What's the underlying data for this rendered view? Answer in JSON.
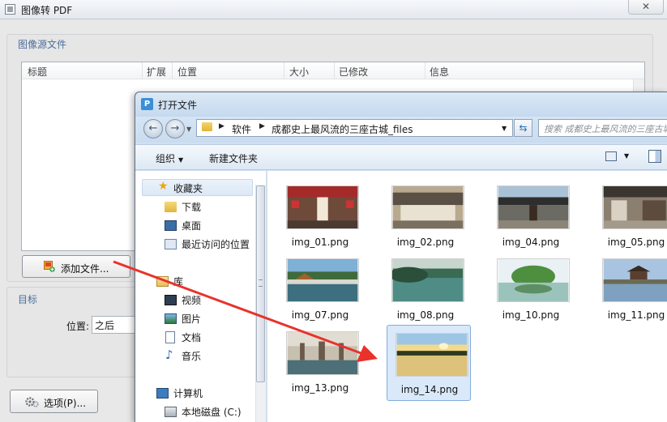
{
  "app": {
    "title": "图像转 PDF",
    "close_glyph": "✕",
    "source_group_title": "图像源文件",
    "columns": [
      "标题",
      "扩展",
      "位置",
      "大小",
      "已修改",
      "信息"
    ],
    "add_files_button": "添加文件...",
    "target_group_title": "目标",
    "position_label": "位置:",
    "position_value": "之后",
    "options_button": "选项(P)..."
  },
  "dialog": {
    "title": "打开文件",
    "icon_letter": "P",
    "breadcrumb": [
      "软件",
      "成都史上最风流的三座古城_files"
    ],
    "search_placeholder": "搜索 成都史上最风流的三座古城_files",
    "toolbar": {
      "organize": "组织",
      "new_folder": "新建文件夹"
    },
    "nav": {
      "favorites": "收藏夹",
      "favorites_items": [
        "下载",
        "桌面",
        "最近访问的位置"
      ],
      "libraries": "库",
      "library_items": [
        "视频",
        "图片",
        "文档",
        "音乐"
      ],
      "computer": "计算机",
      "computer_items": [
        "本地磁盘 (C:)"
      ]
    },
    "files": [
      {
        "name": "img_01.png",
        "theme": "gate"
      },
      {
        "name": "img_02.png",
        "theme": "sepia"
      },
      {
        "name": "img_04.png",
        "theme": "village"
      },
      {
        "name": "img_05.png",
        "theme": "street"
      },
      {
        "name": "img_07.png",
        "theme": "bridge"
      },
      {
        "name": "img_08.png",
        "theme": "river"
      },
      {
        "name": "img_10.png",
        "theme": "lake"
      },
      {
        "name": "img_11.png",
        "theme": "pavilion"
      },
      {
        "name": "img_13.png",
        "theme": "square"
      },
      {
        "name": "img_14.png",
        "theme": "sunset",
        "selected": true
      }
    ]
  },
  "colors": {
    "annotation_arrow": "#e8322b",
    "selection_fill": "#d9e9f9",
    "group_title": "#4a6e9c"
  }
}
